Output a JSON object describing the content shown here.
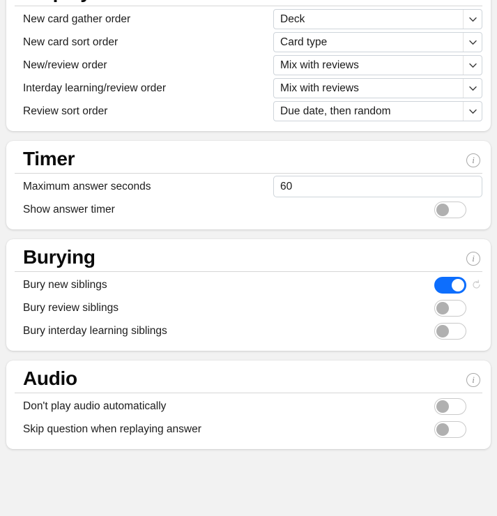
{
  "theme": {
    "page_background": "#f2f2f2",
    "card_background": "#ffffff",
    "accent_on": "#0d6efd",
    "toggle_off_knob": "#b0b0b0",
    "border": "#ced4da",
    "text": "#1a1a1a",
    "muted": "#8d8d8d"
  },
  "sections": [
    {
      "title": "Display Order",
      "info_icon": "info-icon",
      "rows": [
        {
          "label": "New card gather order",
          "type": "select",
          "value": "Deck",
          "icon": "chevron-down-icon"
        },
        {
          "label": "New card sort order",
          "type": "select",
          "value": "Card type",
          "icon": "chevron-down-icon"
        },
        {
          "label": "New/review order",
          "type": "select",
          "value": "Mix with reviews",
          "icon": "chevron-down-icon"
        },
        {
          "label": "Interday learning/review order",
          "type": "select",
          "value": "Mix with reviews",
          "icon": "chevron-down-icon"
        },
        {
          "label": "Review sort order",
          "type": "select",
          "value": "Due date, then random",
          "icon": "chevron-down-icon"
        }
      ]
    },
    {
      "title": "Timer",
      "info_icon": "info-icon",
      "rows": [
        {
          "label": "Maximum answer seconds",
          "type": "text",
          "value": "60"
        },
        {
          "label": "Show answer timer",
          "type": "toggle",
          "value": "off",
          "revert": false
        }
      ]
    },
    {
      "title": "Burying",
      "info_icon": "info-icon",
      "rows": [
        {
          "label": "Bury new siblings",
          "type": "toggle",
          "value": "on",
          "revert": true,
          "revert_icon": "revert-icon"
        },
        {
          "label": "Bury review siblings",
          "type": "toggle",
          "value": "off",
          "revert": false
        },
        {
          "label": "Bury interday learning siblings",
          "type": "toggle",
          "value": "off",
          "revert": false
        }
      ]
    },
    {
      "title": "Audio",
      "info_icon": "info-icon",
      "rows": [
        {
          "label": "Don't play audio automatically",
          "type": "toggle",
          "value": "off",
          "revert": false
        },
        {
          "label": "Skip question when replaying answer",
          "type": "toggle",
          "value": "off",
          "revert": false
        }
      ]
    }
  ]
}
